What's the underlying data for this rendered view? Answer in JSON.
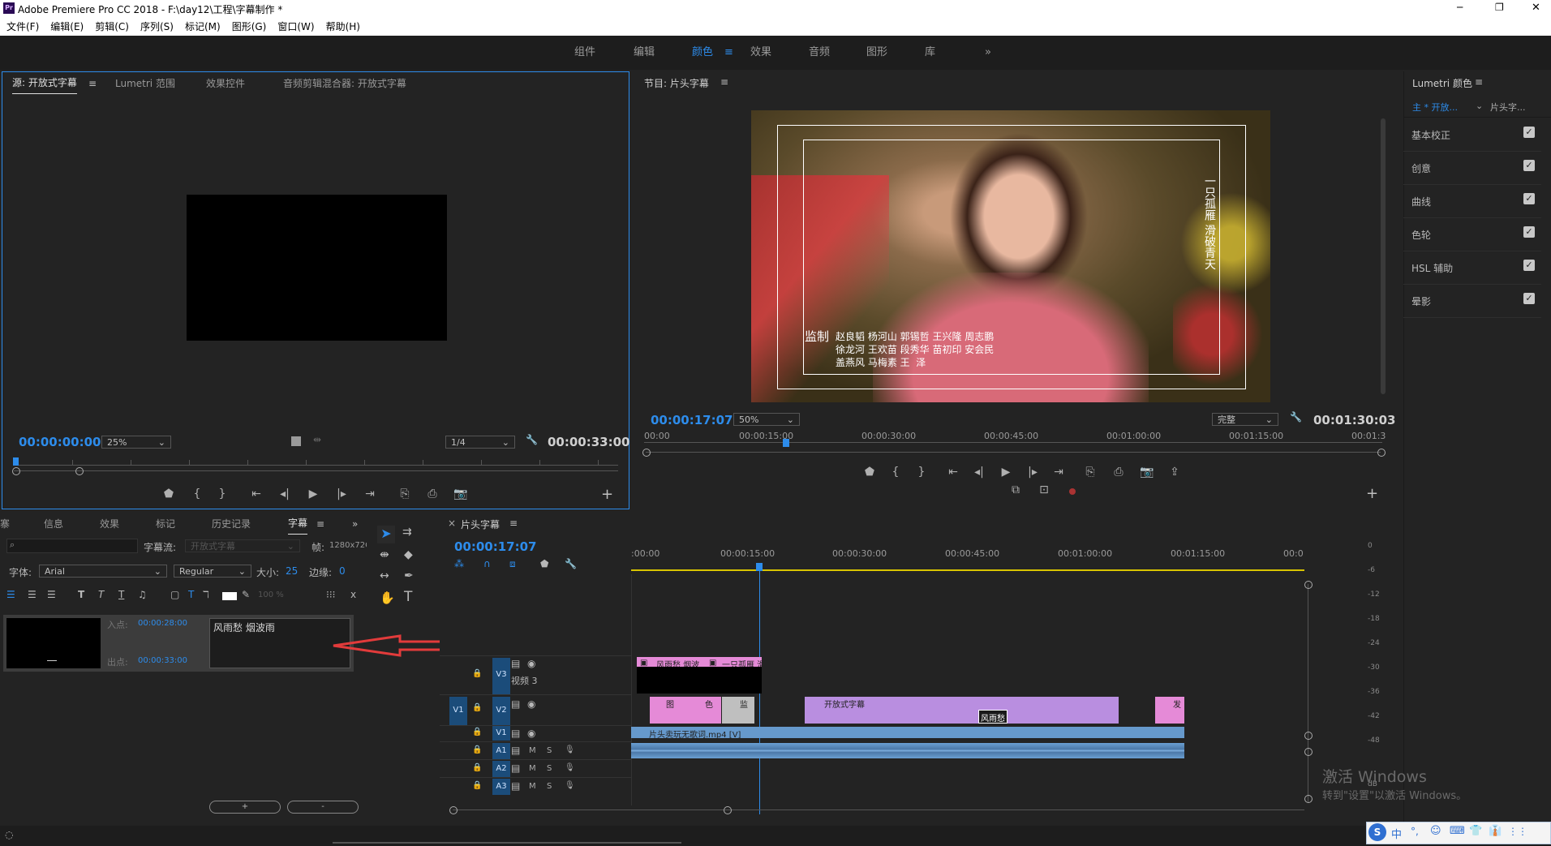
{
  "app": {
    "title": "Adobe Premiere Pro CC 2018 - F:\\day12\\工程\\字幕制作 *",
    "logo": "Pr",
    "window_controls": [
      "─",
      "❐",
      "✕"
    ]
  },
  "menu": [
    "文件(F)",
    "编辑(E)",
    "剪辑(C)",
    "序列(S)",
    "标记(M)",
    "图形(G)",
    "窗口(W)",
    "帮助(H)"
  ],
  "workspaces": [
    {
      "label": "组件"
    },
    {
      "label": "编辑"
    },
    {
      "label": "颜色",
      "active": true
    },
    {
      "label": "效果"
    },
    {
      "label": "音频"
    },
    {
      "label": "图形"
    },
    {
      "label": "库"
    }
  ],
  "workspace_more": "»",
  "source_panel": {
    "tabs": [
      "源: 开放式字幕",
      "Lumetri 范围",
      "效果控件",
      "音频剪辑混合器: 开放式字幕"
    ],
    "menu_glyph": "≡",
    "timecode": "00:00:00:00",
    "zoom": "25%",
    "resolution": "1/4",
    "duration": "00:00:33:00"
  },
  "program_panel": {
    "title": "节目: 片头字幕",
    "menu_glyph": "≡",
    "timecode": "00:00:17:07",
    "zoom": "50%",
    "quality": "完整",
    "duration": "00:01:30:03",
    "ruler": [
      "00:00",
      "00:00:15:00",
      "00:00:30:00",
      "00:00:45:00",
      "00:01:00:00",
      "00:01:15:00",
      "00:01:3"
    ],
    "video": {
      "vertical_caption": "一只孤雁 滑破青天",
      "credit_label": "监制",
      "credit_lines": [
        "赵良韬 杨河山 郭锡哲 王兴隆 周志鹏",
        "徐龙河 王欢苗 段秀华 苗初印 安会民",
        "盖燕风 马梅素 王  泽"
      ]
    }
  },
  "lumetri": {
    "title": "Lumetri 颜色",
    "menu_glyph": "≡",
    "master": "主 * 开放...",
    "clip": "片头字...",
    "sections": [
      "基本校正",
      "创意",
      "曲线",
      "色轮",
      "HSL 辅助",
      "晕影"
    ]
  },
  "captions_panel": {
    "tabs": [
      "寨",
      "信息",
      "效果",
      "标记",
      "历史记录",
      "字幕"
    ],
    "active_tab": "字幕",
    "more": "»",
    "search_placeholder": "",
    "stream_label": "字幕流:",
    "stream_value": "开放式字幕",
    "frame_label": "帧:",
    "frame_value": "1280x72C",
    "font_label": "字体:",
    "font_value": "Arial",
    "style_value": "Regular",
    "size_label": "大小:",
    "size_value": "25",
    "edge_label": "边缘:",
    "edge_value": "0",
    "opacity_value": "100 %",
    "in_label": "入点:",
    "in_value": "00:00:28:00",
    "out_label": "出点:",
    "out_value": "00:00:33:00",
    "caption_text": "风雨愁 烟波雨",
    "add_btn": "+",
    "remove_btn": "-"
  },
  "timeline": {
    "title": "片头字幕",
    "close": "×",
    "menu_glyph": "≡",
    "timecode": "00:00:17:07",
    "ruler": [
      ":00:00",
      "00:00:15:00",
      "00:00:30:00",
      "00:00:45:00",
      "00:01:00:00",
      "00:01:15:00",
      "00:0"
    ],
    "tracks": [
      {
        "id": "V3",
        "name": "视频 3"
      },
      {
        "id": "V2",
        "name": ""
      },
      {
        "id": "V1",
        "name": ""
      },
      {
        "id": "A1",
        "name": ""
      },
      {
        "id": "A2",
        "name": ""
      },
      {
        "id": "A3",
        "name": ""
      }
    ],
    "source_patch": "V1",
    "mute": "M",
    "solo": "S",
    "clips": {
      "v3a": "风雨愁 烟波",
      "v3b": "一只孤雁 滑",
      "v2a": "图",
      "v2b": "色",
      "v2c": "监",
      "v2d": "开放式字幕",
      "v2e": "风雨愁",
      "v2f": "发",
      "v1": "片头卖玩无歌词.mp4 [V]"
    }
  },
  "vu_scale": [
    "0",
    "-6",
    "-12",
    "-18",
    "-24",
    "-30",
    "-36",
    "-42",
    "-48",
    "dB"
  ],
  "watermark": {
    "line1": "激活 Windows",
    "line2": "转到\"设置\"以激活 Windows。"
  },
  "ime": [
    "中",
    "°,",
    "☺",
    "⌨",
    "👕",
    "👔",
    "⋮⋮"
  ],
  "colors": {
    "accent": "#2d8ceb",
    "pink_clip": "#e58ad7",
    "violet_clip": "#b98ee0",
    "audio_clip": "#6699cc",
    "arrow": "#e23b3b"
  }
}
